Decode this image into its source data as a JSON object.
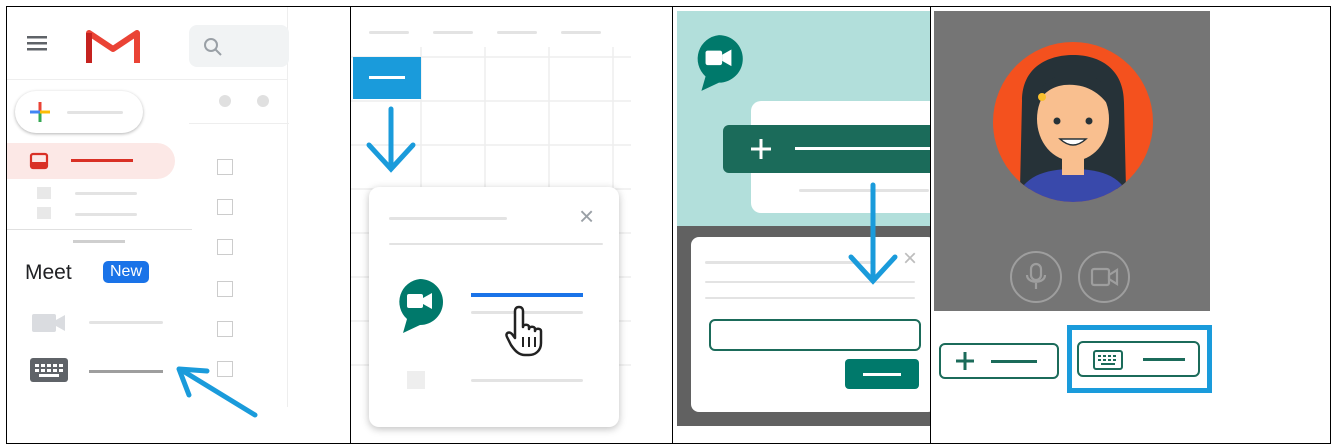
{
  "gmail_panel": {
    "meet_label": "Meet",
    "new_badge": "New",
    "icons": [
      "menu-icon",
      "gmail-logo-icon",
      "search-icon",
      "compose-plus-icon",
      "inbox-icon",
      "video-camera-icon",
      "keyboard-icon"
    ]
  },
  "calendar_panel": {
    "close_symbol": "×",
    "icons": [
      "google-meet-icon",
      "hand-pointer-icon",
      "close-icon"
    ]
  },
  "meet_home_panel": {
    "close_symbol": "×",
    "icons": [
      "google-meet-icon",
      "plus-icon"
    ]
  },
  "preview_panel": {
    "icons": [
      "avatar",
      "microphone-icon",
      "camera-icon",
      "plus-icon",
      "keyboard-icon"
    ]
  },
  "colors": {
    "gmail_red": "#ea4335",
    "meet_green": "#00796b",
    "arrow_blue": "#1a9bdb",
    "teal_bg": "#b2dfdb",
    "preview_gray": "#757575",
    "avatar_orange": "#f4511e"
  }
}
